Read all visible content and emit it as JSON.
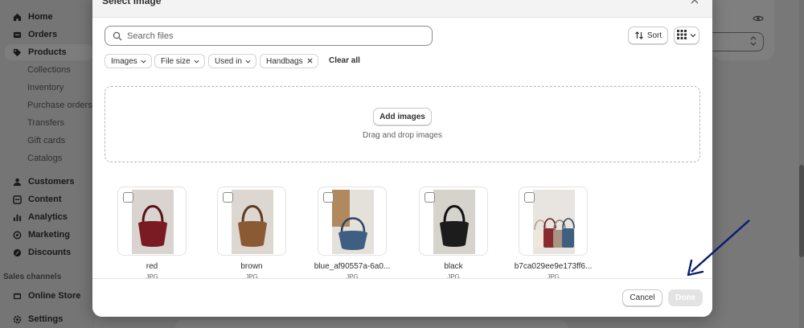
{
  "sidebar": {
    "items": [
      {
        "label": "Home",
        "icon": "home-icon"
      },
      {
        "label": "Orders",
        "icon": "orders-icon"
      },
      {
        "label": "Products",
        "icon": "tag-icon",
        "active": true
      },
      {
        "label": "Collections"
      },
      {
        "label": "Inventory"
      },
      {
        "label": "Purchase orders"
      },
      {
        "label": "Transfers"
      },
      {
        "label": "Gift cards"
      },
      {
        "label": "Catalogs"
      },
      {
        "label": "Customers",
        "icon": "person-icon"
      },
      {
        "label": "Content",
        "icon": "content-icon"
      },
      {
        "label": "Analytics",
        "icon": "bar-chart-icon"
      },
      {
        "label": "Marketing",
        "icon": "target-icon"
      },
      {
        "label": "Discounts",
        "icon": "discount-icon"
      }
    ],
    "section_label": "Sales channels",
    "channel_item": "Online Store",
    "settings_item": "Settings"
  },
  "modal": {
    "title": "Select image",
    "search_placeholder": "Search files",
    "sort_label": "Sort",
    "filters": [
      "Images",
      "File size",
      "Used in"
    ],
    "active_filter": "Handbags",
    "clear_all": "Clear all",
    "add_images": "Add images",
    "drop_hint": "Drag and drop images",
    "files": [
      {
        "name": "red",
        "type": "JPG",
        "color": "#7a1a22"
      },
      {
        "name": "brown",
        "type": "JPG",
        "color": "#8a5a35"
      },
      {
        "name": "blue_af90557a-6a0...",
        "type": "JPG",
        "color": "#3e5f82"
      },
      {
        "name": "black",
        "type": "JPG",
        "color": "#1c1c1c"
      },
      {
        "name": "b7ca029ee9e173ff6...",
        "type": "JPG",
        "color": "#c9b8a8"
      }
    ],
    "cancel": "Cancel",
    "done": "Done"
  },
  "colors": {
    "annotation_arrow": "#0a1a6e",
    "overlay": "rgba(0,0,0,0.5)"
  }
}
